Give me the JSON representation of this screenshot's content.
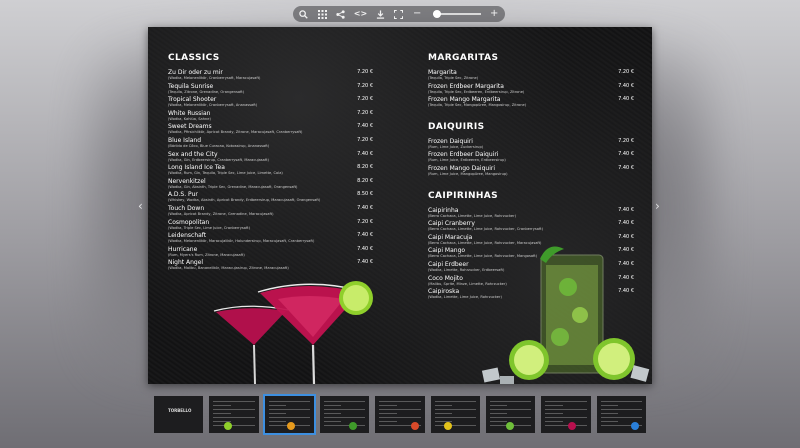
{
  "toolbar": {
    "icons": [
      "search-icon",
      "grid-icon",
      "share-icon",
      "embed-icon",
      "download-icon",
      "fullscreen-icon",
      "zoom-out-icon",
      "zoom-in-icon"
    ],
    "embed_glyph": "<>",
    "zoom_out_glyph": "−",
    "zoom_in_glyph": "+",
    "zoom_level": 0
  },
  "nav": {
    "prev_glyph": "‹",
    "next_glyph": "›"
  },
  "menu": {
    "classics": {
      "title": "CLASSICS",
      "items": [
        {
          "name": "Zu Dir oder zu mir",
          "desc": "(Wodka, Melonenlikör, Cranberrysaft, Maracujasaft)",
          "price": "7.20 €"
        },
        {
          "name": "Tequila Sunrise",
          "desc": "(Tequila, Zitrone, Grenadine, Orangensaft)",
          "price": "7.20 €"
        },
        {
          "name": "Tropical Shooter",
          "desc": "(Wodka, Melonenlikör, Cranberrysaft, Ananassaft)",
          "price": "7.20 €"
        },
        {
          "name": "White Russian",
          "desc": "(Wodka, Kahlúa, Sahne)",
          "price": "7.20 €"
        },
        {
          "name": "Sweet Dreams",
          "desc": "(Wodka, Pfirsichlikör, Apricot Brandy, Zitrone, Maracujasaft, Cranberrysaft)",
          "price": "7.40 €"
        },
        {
          "name": "Blue Island",
          "desc": "(Bárlido de Côco, Blue Curacao, Kokossirup, Ananassaft)",
          "price": "7.20 €"
        },
        {
          "name": "Sex and the City",
          "desc": "(Wodka, Gin, Erdbeersirup, Cranberrysaft, Maracujasaft)",
          "price": "7.40 €"
        },
        {
          "name": "Long Island Ice Tea",
          "desc": "(Wodka, Rum, Gin, Tequila, Triple Sec, Lime Juice, Limette, Cola)",
          "price": "8.20 €"
        },
        {
          "name": "Nervenkitzel",
          "desc": "(Wodka, Gin, Absinth, Triple Sec, Grenadine, Maracujasaft, Orangensaft)",
          "price": "8.20 €"
        },
        {
          "name": "A.D.S. Pur",
          "desc": "(Whiskey, Wodka, Absinth, Apricot Brandy, Erdbeersirup, Maracujasaft, Orangensaft)",
          "price": "8.50 €"
        },
        {
          "name": "Touch Down",
          "desc": "(Wodka, Apricot Brandy, Zitrone, Grenadine, Maracujasaft)",
          "price": "7.40 €"
        },
        {
          "name": "Cosmopolitan",
          "desc": "(Wodka, Triple Sec, Lime Juice, Cranberrysaft)",
          "price": "7.20 €"
        },
        {
          "name": "Leidenschaft",
          "desc": "(Wodka, Melonenlikör, Maracujalikör, Holundersirup, Maracujasaft, Cranberrysaft)",
          "price": "7.40 €"
        },
        {
          "name": "Hurricane",
          "desc": "(Rum, Myers's Rum, Zitrone, Maracujasaft)",
          "price": "7.40 €"
        },
        {
          "name": "Night Angel",
          "desc": "(Wodka, Malibu, Bananelikör, Maracujasirup, Zitrone, Maracujasaft)",
          "price": "7.40 €"
        }
      ]
    },
    "margaritas": {
      "title": "MARGARITAS",
      "items": [
        {
          "name": "Margarita",
          "desc": "(Tequila, Triple Sec, Zitrone)",
          "price": "7.20 €"
        },
        {
          "name": "Frozen Erdbeer Margarita",
          "desc": "(Tequila, Triple Sec, Erdbeeren, Erdbeersirup, Zitrone)",
          "price": "7.40 €"
        },
        {
          "name": "Frozen Mango Margarita",
          "desc": "(Tequila, Triple Sec, Mangopüree, Mangosirup, Zitrone)",
          "price": "7.40 €"
        }
      ]
    },
    "daiquiris": {
      "title": "DAIQUIRIS",
      "items": [
        {
          "name": "Frozen Daiquiri",
          "desc": "(Rum, Lime Juice, Zuckersirup)",
          "price": "7.20 €"
        },
        {
          "name": "Frozen Erdbeer Daiquiri",
          "desc": "(Rum, Lime Juice, Erdbeeren, Erdbeersirup)",
          "price": "7.40 €"
        },
        {
          "name": "Frozen Mango Daiquiri",
          "desc": "(Rum, Lime Juice, Mangopüree, Mangosirup)",
          "price": "7.40 €"
        }
      ]
    },
    "caipirinhas": {
      "title": "CAIPIRINHAS",
      "items": [
        {
          "name": "Caipirinha",
          "desc": "(Berro Cachaca, Limette, Lime Juice, Rohrzucker)",
          "price": "7.40 €"
        },
        {
          "name": "Caipi Cranberry",
          "desc": "(Berro Cachaca, Limette, Lime Juice, Rohrzucker, Cranberrysaft)",
          "price": "7.40 €"
        },
        {
          "name": "Caipi Maracuja",
          "desc": "(Berro Cachaca, Limette, Lime Juice, Rohrzucker, Maracujasaft)",
          "price": "7.40 €"
        },
        {
          "name": "Caipi Mango",
          "desc": "(Berro Cachaca, Limette, Lime Juice, Rohrzucker, Mangosaft)",
          "price": "7.40 €"
        },
        {
          "name": "Caipi Erdbeer",
          "desc": "(Wodka, Limette, Rohrzucker, Erdbeersaft)",
          "price": "7.40 €"
        },
        {
          "name": "Coco Mojito",
          "desc": "(Malibu, Sprite, Minze, Limette, Rohrzucker)",
          "price": "7.40 €"
        },
        {
          "name": "Caipiroska",
          "desc": "(Wodka, Limette, Lime Juice, Rohrzucker)",
          "price": "7.40 €"
        }
      ]
    }
  },
  "thumbnails": {
    "count": 9,
    "active_index": 2,
    "cover_logo": "TORBELLO"
  },
  "colors": {
    "accent": "#3d8fe0",
    "page_bg": "#141415"
  }
}
